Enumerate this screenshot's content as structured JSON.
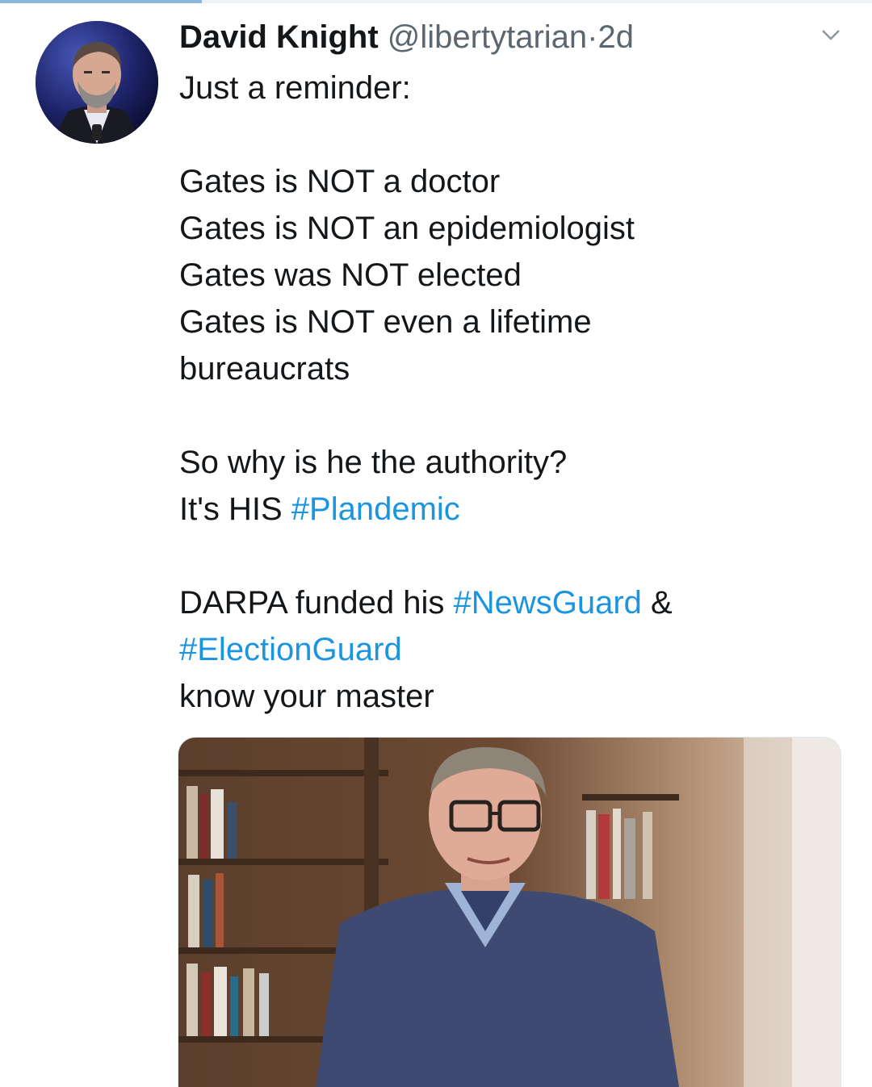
{
  "tweet": {
    "author_name": "David Knight",
    "author_handle": "@libertytarian",
    "separator": "·",
    "timestamp": "2d",
    "avatar_icon": "profile-photo",
    "menu_icon": "chevron-down-icon",
    "lines": {
      "l1": "Just a reminder:",
      "l2": "Gates is NOT a doctor",
      "l3": "Gates is NOT an epidemiologist",
      "l4": "Gates was NOT elected",
      "l5": "Gates is NOT even a lifetime",
      "l6": "bureaucrats",
      "l7": "So why is he the authority?",
      "l8_prefix": "It's HIS ",
      "l8_tag": "#Plandemic",
      "l9_prefix": "DARPA funded his ",
      "l9_tag": "#NewsGuard",
      "l9_suffix": " &",
      "l10_tag": "#ElectionGuard",
      "l11": "know your master"
    },
    "hashtag_color": "#1b95e0",
    "media_description_icon": "attached-photo"
  }
}
